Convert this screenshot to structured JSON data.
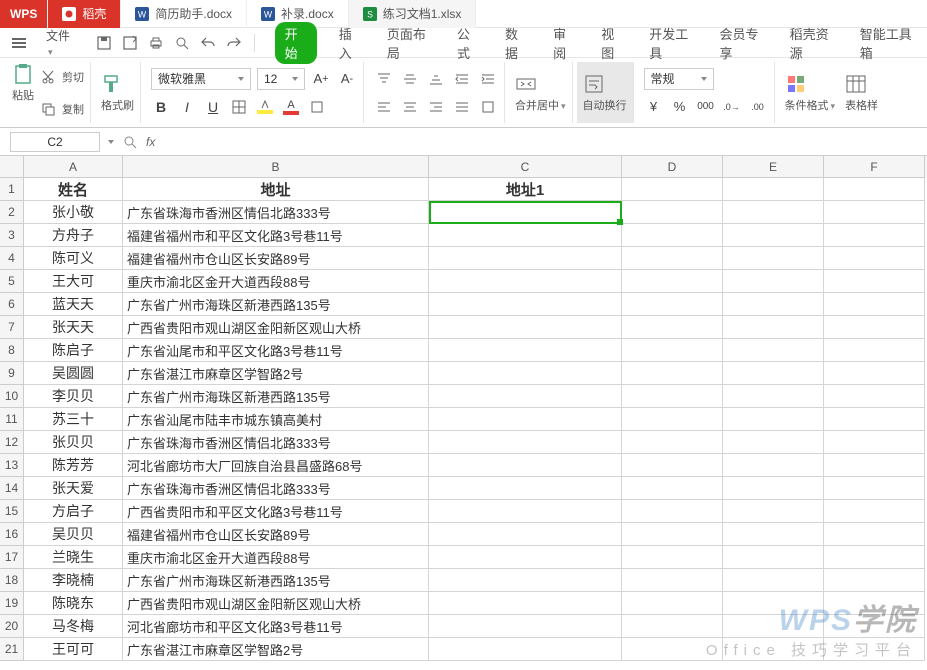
{
  "titlebar": {
    "wps": "WPS",
    "tabs": [
      {
        "label": "稻壳",
        "icon": "rice-icon",
        "color": "#d9332a"
      },
      {
        "label": "简历助手.docx",
        "icon": "word-icon",
        "color": "#2b579a"
      },
      {
        "label": "补录.docx",
        "icon": "word-icon",
        "color": "#2b579a"
      },
      {
        "label": "练习文档1.xlsx",
        "icon": "excel-icon",
        "color": "#1d8e3f"
      }
    ]
  },
  "menubar": {
    "file": "文件",
    "main_tabs": [
      "开始",
      "插入",
      "页面布局",
      "公式",
      "数据",
      "审阅",
      "视图",
      "开发工具",
      "会员专享",
      "稻壳资源",
      "智能工具箱"
    ],
    "active_tab": "开始"
  },
  "ribbon": {
    "paste": "粘贴",
    "cut": "剪切",
    "copy": "复制",
    "format_painter": "格式刷",
    "font_name": "微软雅黑",
    "font_size": "12",
    "merge_center": "合并居中",
    "wrap_text": "自动换行",
    "style": "常规",
    "cond_format": "条件格式",
    "table_style": "表格样"
  },
  "namebox": {
    "cell_ref": "C2",
    "fx": "fx",
    "formula": ""
  },
  "columns": [
    "A",
    "B",
    "C",
    "D",
    "E",
    "F"
  ],
  "col_widths": {
    "A": 99,
    "B": 306,
    "C": 193,
    "D": 101,
    "E": 101,
    "F": 101
  },
  "header_row": {
    "A": "姓名",
    "B": "地址",
    "C": "地址1"
  },
  "rows": [
    {
      "n": 2,
      "A": "张小敬",
      "B": "广东省珠海市香洲区情侣北路333号"
    },
    {
      "n": 3,
      "A": "方舟子",
      "B": "福建省福州市和平区文化路3号巷11号"
    },
    {
      "n": 4,
      "A": "陈可义",
      "B": "福建省福州市仓山区长安路89号"
    },
    {
      "n": 5,
      "A": "王大可",
      "B": "重庆市渝北区金开大道西段88号"
    },
    {
      "n": 6,
      "A": "蓝天天",
      "B": "广东省广州市海珠区新港西路135号"
    },
    {
      "n": 7,
      "A": "张天天",
      "B": "广西省贵阳市观山湖区金阳新区观山大桥"
    },
    {
      "n": 8,
      "A": "陈启子",
      "B": "广东省汕尾市和平区文化路3号巷11号"
    },
    {
      "n": 9,
      "A": "吴圆圆",
      "B": "广东省湛江市麻章区学智路2号"
    },
    {
      "n": 10,
      "A": "李贝贝",
      "B": "广东省广州市海珠区新港西路135号"
    },
    {
      "n": 11,
      "A": "苏三十",
      "B": "广东省汕尾市陆丰市城东镇高美村"
    },
    {
      "n": 12,
      "A": "张贝贝",
      "B": "广东省珠海市香洲区情侣北路333号"
    },
    {
      "n": 13,
      "A": "陈芳芳",
      "B": "河北省廊坊市大厂回族自治县昌盛路68号"
    },
    {
      "n": 14,
      "A": "张天爱",
      "B": "广东省珠海市香洲区情侣北路333号"
    },
    {
      "n": 15,
      "A": "方启子",
      "B": "广西省贵阳市和平区文化路3号巷11号"
    },
    {
      "n": 16,
      "A": "吴贝贝",
      "B": "福建省福州市仓山区长安路89号"
    },
    {
      "n": 17,
      "A": "兰晓生",
      "B": "重庆市渝北区金开大道西段88号"
    },
    {
      "n": 18,
      "A": "李晓楠",
      "B": "广东省广州市海珠区新港西路135号"
    },
    {
      "n": 19,
      "A": "陈晓东",
      "B": "广西省贵阳市观山湖区金阳新区观山大桥"
    },
    {
      "n": 20,
      "A": "马冬梅",
      "B": "河北省廊坊市和平区文化路3号巷11号"
    },
    {
      "n": 21,
      "A": "王可可",
      "B": "广东省湛江市麻章区学智路2号"
    }
  ],
  "active_cell": "C2",
  "watermark": {
    "brand": "WPS",
    "academy": "学院",
    "subtitle": "Office 技巧学习平台"
  }
}
